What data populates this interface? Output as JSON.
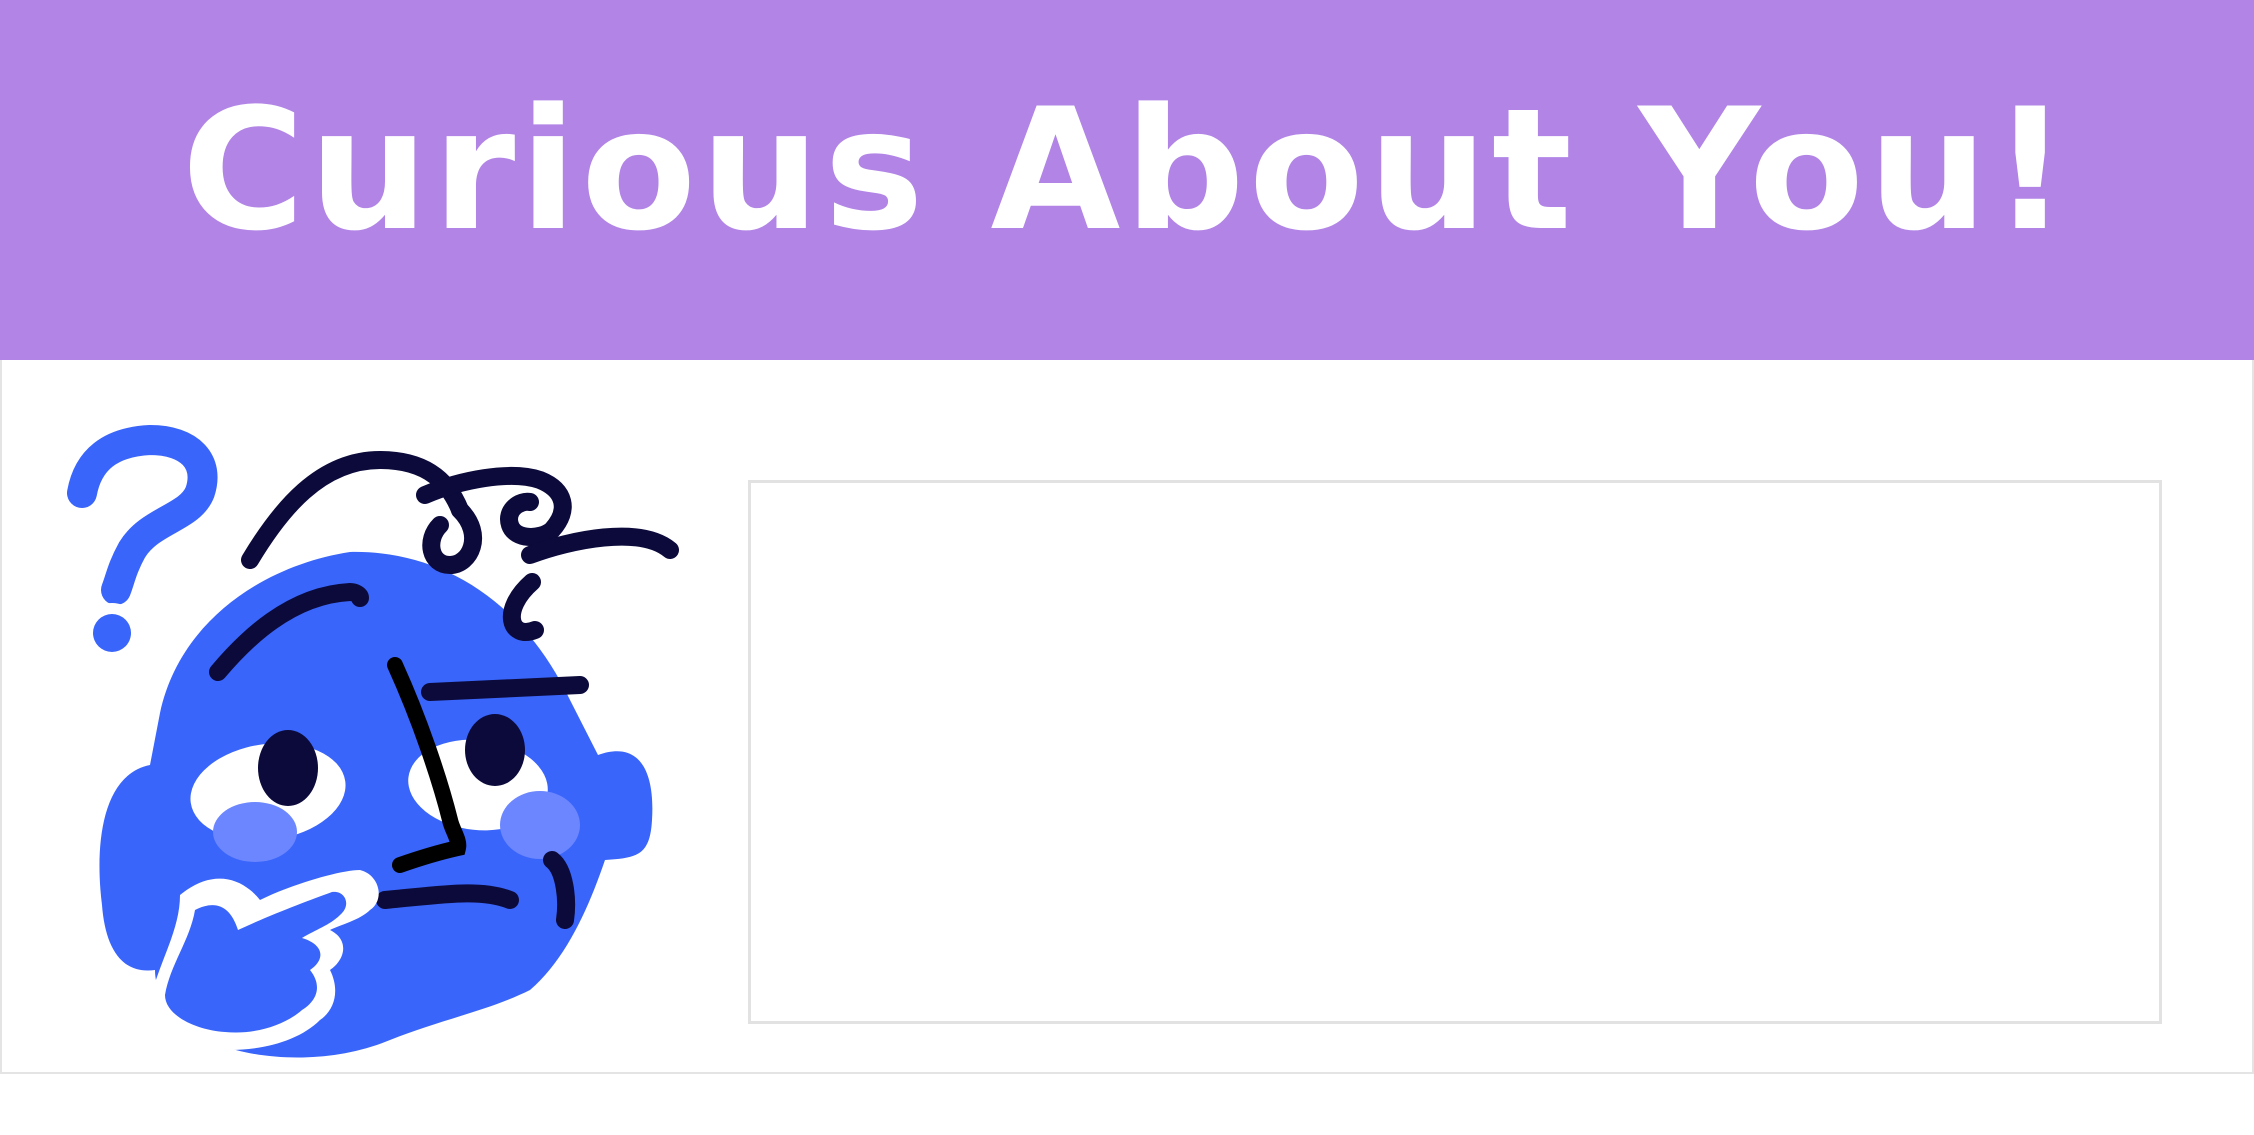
{
  "banner": {
    "title": "Curious About You!",
    "background_color": "#b184e6",
    "text_color": "#ffffff"
  },
  "sticker": {
    "icon": "thinking-face-icon",
    "accent_color": "#3965fa",
    "question_mark_icon": "question-mark-icon"
  },
  "answer_box": {
    "value": ""
  }
}
